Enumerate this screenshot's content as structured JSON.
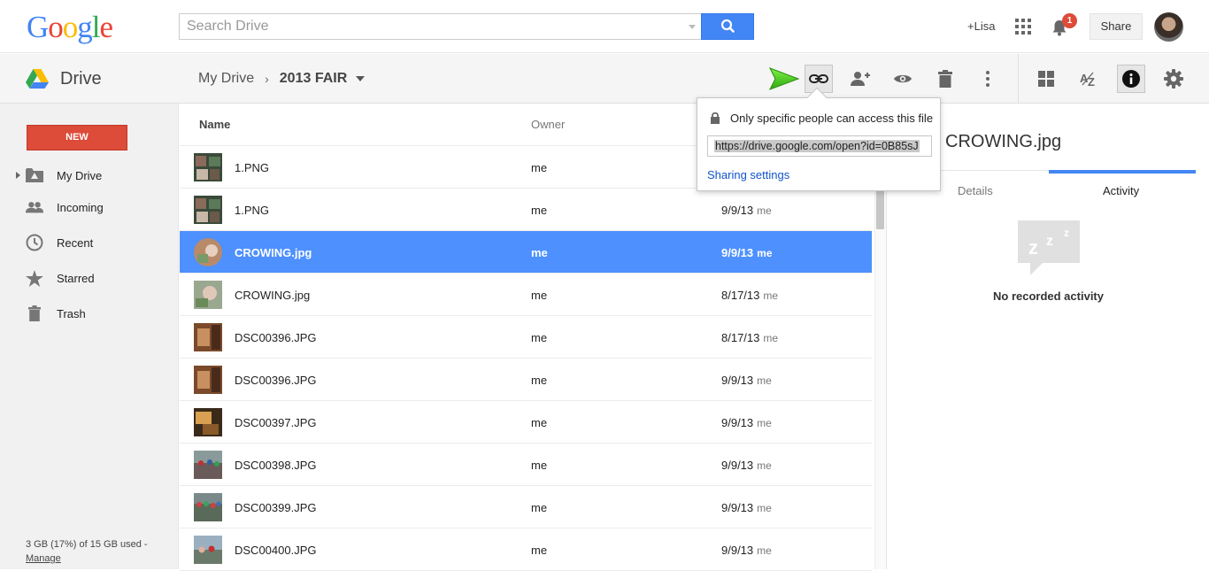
{
  "header": {
    "logo_letters": [
      "G",
      "o",
      "o",
      "g",
      "l",
      "e"
    ],
    "search_placeholder": "Search Drive",
    "user_link": "+Lisa",
    "notification_count": "1",
    "share_label": "Share"
  },
  "toolbar": {
    "app_name": "Drive",
    "breadcrumb_root": "My Drive",
    "breadcrumb_separator": "›",
    "breadcrumb_current": "2013 FAIR",
    "icons": [
      "link-icon",
      "add-person-icon",
      "preview-eye-icon",
      "trash-icon",
      "more-vert-icon",
      "grid-view-icon",
      "sort-az-icon",
      "info-icon",
      "settings-gear-icon"
    ]
  },
  "sidebar": {
    "new_label": "NEW",
    "items": [
      {
        "label": "My Drive",
        "icon": "drive-folder-icon"
      },
      {
        "label": "Incoming",
        "icon": "people-icon"
      },
      {
        "label": "Recent",
        "icon": "clock-icon"
      },
      {
        "label": "Starred",
        "icon": "star-icon"
      },
      {
        "label": "Trash",
        "icon": "trash-icon"
      }
    ],
    "storage_text": "3 GB (17%) of 15 GB used -",
    "manage_label": "Manage"
  },
  "file_list": {
    "columns": {
      "name": "Name",
      "owner": "Owner"
    },
    "rows": [
      {
        "name": "1.PNG",
        "owner": "me",
        "date": "",
        "by": ""
      },
      {
        "name": "1.PNG",
        "owner": "me",
        "date": "9/9/13",
        "by": "me"
      },
      {
        "name": "CROWING.jpg",
        "owner": "me",
        "date": "9/9/13",
        "by": "me"
      },
      {
        "name": "CROWING.jpg",
        "owner": "me",
        "date": "8/17/13",
        "by": "me"
      },
      {
        "name": "DSC00396.JPG",
        "owner": "me",
        "date": "8/17/13",
        "by": "me"
      },
      {
        "name": "DSC00396.JPG",
        "owner": "me",
        "date": "9/9/13",
        "by": "me"
      },
      {
        "name": "DSC00397.JPG",
        "owner": "me",
        "date": "9/9/13",
        "by": "me"
      },
      {
        "name": "DSC00398.JPG",
        "owner": "me",
        "date": "9/9/13",
        "by": "me"
      },
      {
        "name": "DSC00399.JPG",
        "owner": "me",
        "date": "9/9/13",
        "by": "me"
      },
      {
        "name": "DSC00400.JPG",
        "owner": "me",
        "date": "9/9/13",
        "by": "me"
      }
    ],
    "selected_index": 2
  },
  "details_panel": {
    "title": "CROWING.jpg",
    "tab_details": "Details",
    "tab_activity": "Activity",
    "empty_text": "No recorded activity"
  },
  "link_popup": {
    "access_text": "Only specific people can access this file",
    "link_url": "https://drive.google.com/open?id=0B85sJ",
    "sharing_settings_label": "Sharing settings"
  },
  "colors": {
    "selected_row": "#4d90fe",
    "new_button": "#dd4b39",
    "search_button": "#4285f4",
    "annotation_arrow": "#4cd31c"
  }
}
